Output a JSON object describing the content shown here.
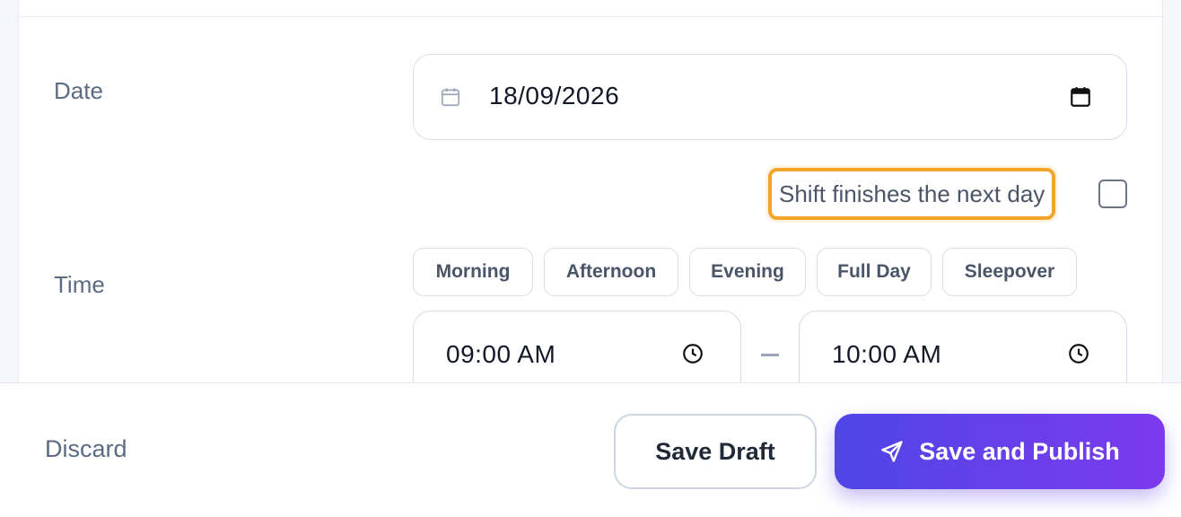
{
  "form": {
    "date": {
      "label": "Date",
      "value": "18/09/2026",
      "icon": "calendar-icon",
      "picker_icon": "calendar-picker-icon"
    },
    "next_day": {
      "label": "Shift finishes the next day",
      "checked": false,
      "highlight_color": "#f0a52a"
    },
    "time": {
      "label": "Time",
      "presets": [
        "Morning",
        "Afternoon",
        "Evening",
        "Full Day",
        "Sleepover"
      ],
      "start": "09:00 AM",
      "separator": "–",
      "end": "10:00 AM",
      "icon": "clock-icon"
    }
  },
  "footer": {
    "discard_label": "Discard",
    "save_draft_label": "Save Draft",
    "publish_label": "Save and Publish",
    "publish_icon": "send-icon",
    "accent_start": "#4f46e5",
    "accent_end": "#7c3aed"
  }
}
